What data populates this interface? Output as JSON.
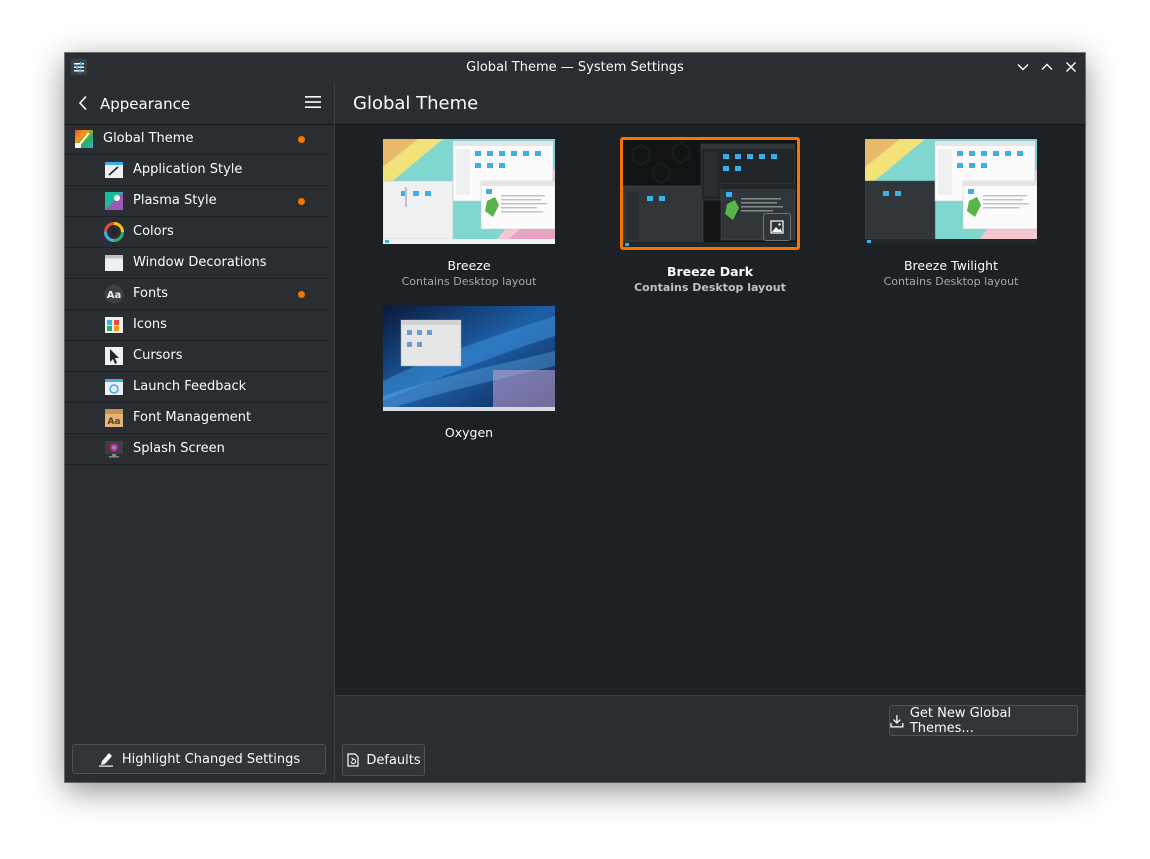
{
  "window": {
    "title": "Global Theme — System Settings"
  },
  "sidebar": {
    "title": "Appearance",
    "items": [
      {
        "label": "Global Theme",
        "icon": "global-theme-icon",
        "changed": true
      },
      {
        "label": "Application Style",
        "icon": "application-style-icon",
        "changed": false
      },
      {
        "label": "Plasma Style",
        "icon": "plasma-style-icon",
        "changed": true
      },
      {
        "label": "Colors",
        "icon": "colors-icon",
        "changed": false
      },
      {
        "label": "Window Decorations",
        "icon": "window-decorations-icon",
        "changed": false
      },
      {
        "label": "Fonts",
        "icon": "fonts-icon",
        "changed": true
      },
      {
        "label": "Icons",
        "icon": "icons-icon",
        "changed": false
      },
      {
        "label": "Cursors",
        "icon": "cursors-icon",
        "changed": false
      },
      {
        "label": "Launch Feedback",
        "icon": "launch-feedback-icon",
        "changed": false
      },
      {
        "label": "Font Management",
        "icon": "font-management-icon",
        "changed": false
      },
      {
        "label": "Splash Screen",
        "icon": "splash-screen-icon",
        "changed": false
      }
    ],
    "highlight_button": "Highlight Changed Settings"
  },
  "main": {
    "title": "Global Theme",
    "themes": [
      {
        "name": "Breeze",
        "desc": "Contains Desktop layout",
        "selected": false
      },
      {
        "name": "Breeze Dark",
        "desc": "Contains Desktop layout",
        "selected": true
      },
      {
        "name": "Breeze Twilight",
        "desc": "Contains Desktop layout",
        "selected": false
      },
      {
        "name": "Oxygen",
        "desc": "",
        "selected": false
      }
    ]
  },
  "footer": {
    "get_new_button": "Get New Global Themes...",
    "defaults_button": "Defaults"
  },
  "colors": {
    "accent": "#f67400",
    "window_bg": "#1d2024",
    "panel_bg": "#2a2e32",
    "text": "#fcfcfc",
    "secondary_text": "#a1a9b1"
  }
}
